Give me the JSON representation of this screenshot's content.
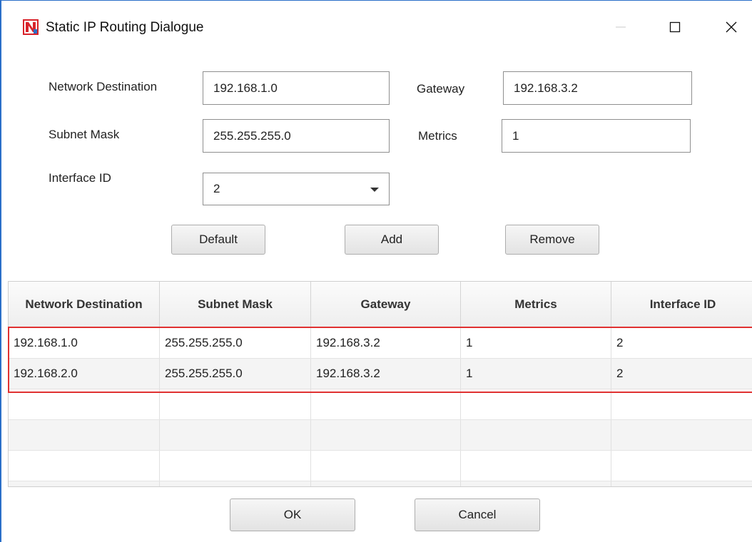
{
  "window": {
    "title": "Static IP Routing Dialogue",
    "icon": "app-logo-icon",
    "controls": [
      "minimize-icon",
      "maximize-icon",
      "close-icon"
    ]
  },
  "form": {
    "network_destination": {
      "label": "Network Destination",
      "value": "192.168.1.0"
    },
    "gateway": {
      "label": "Gateway",
      "value": "192.168.3.2"
    },
    "subnet_mask": {
      "label": "Subnet Mask",
      "value": "255.255.255.0"
    },
    "metrics": {
      "label": "Metrics",
      "value": "1"
    },
    "interface_id": {
      "label": "Interface ID",
      "value": "2"
    }
  },
  "buttons": {
    "default": "Default",
    "add": "Add",
    "remove": "Remove",
    "ok": "OK",
    "cancel": "Cancel"
  },
  "table": {
    "columns": [
      "Network Destination",
      "Subnet Mask",
      "Gateway",
      "Metrics",
      "Interface ID"
    ],
    "rows": [
      [
        "192.168.1.0",
        "255.255.255.0",
        "192.168.3.2",
        "1",
        "2"
      ],
      [
        "192.168.2.0",
        "255.255.255.0",
        "192.168.3.2",
        "1",
        "2"
      ]
    ]
  },
  "colors": {
    "highlight": "#e03131",
    "window_border": "#2b6fc8"
  }
}
